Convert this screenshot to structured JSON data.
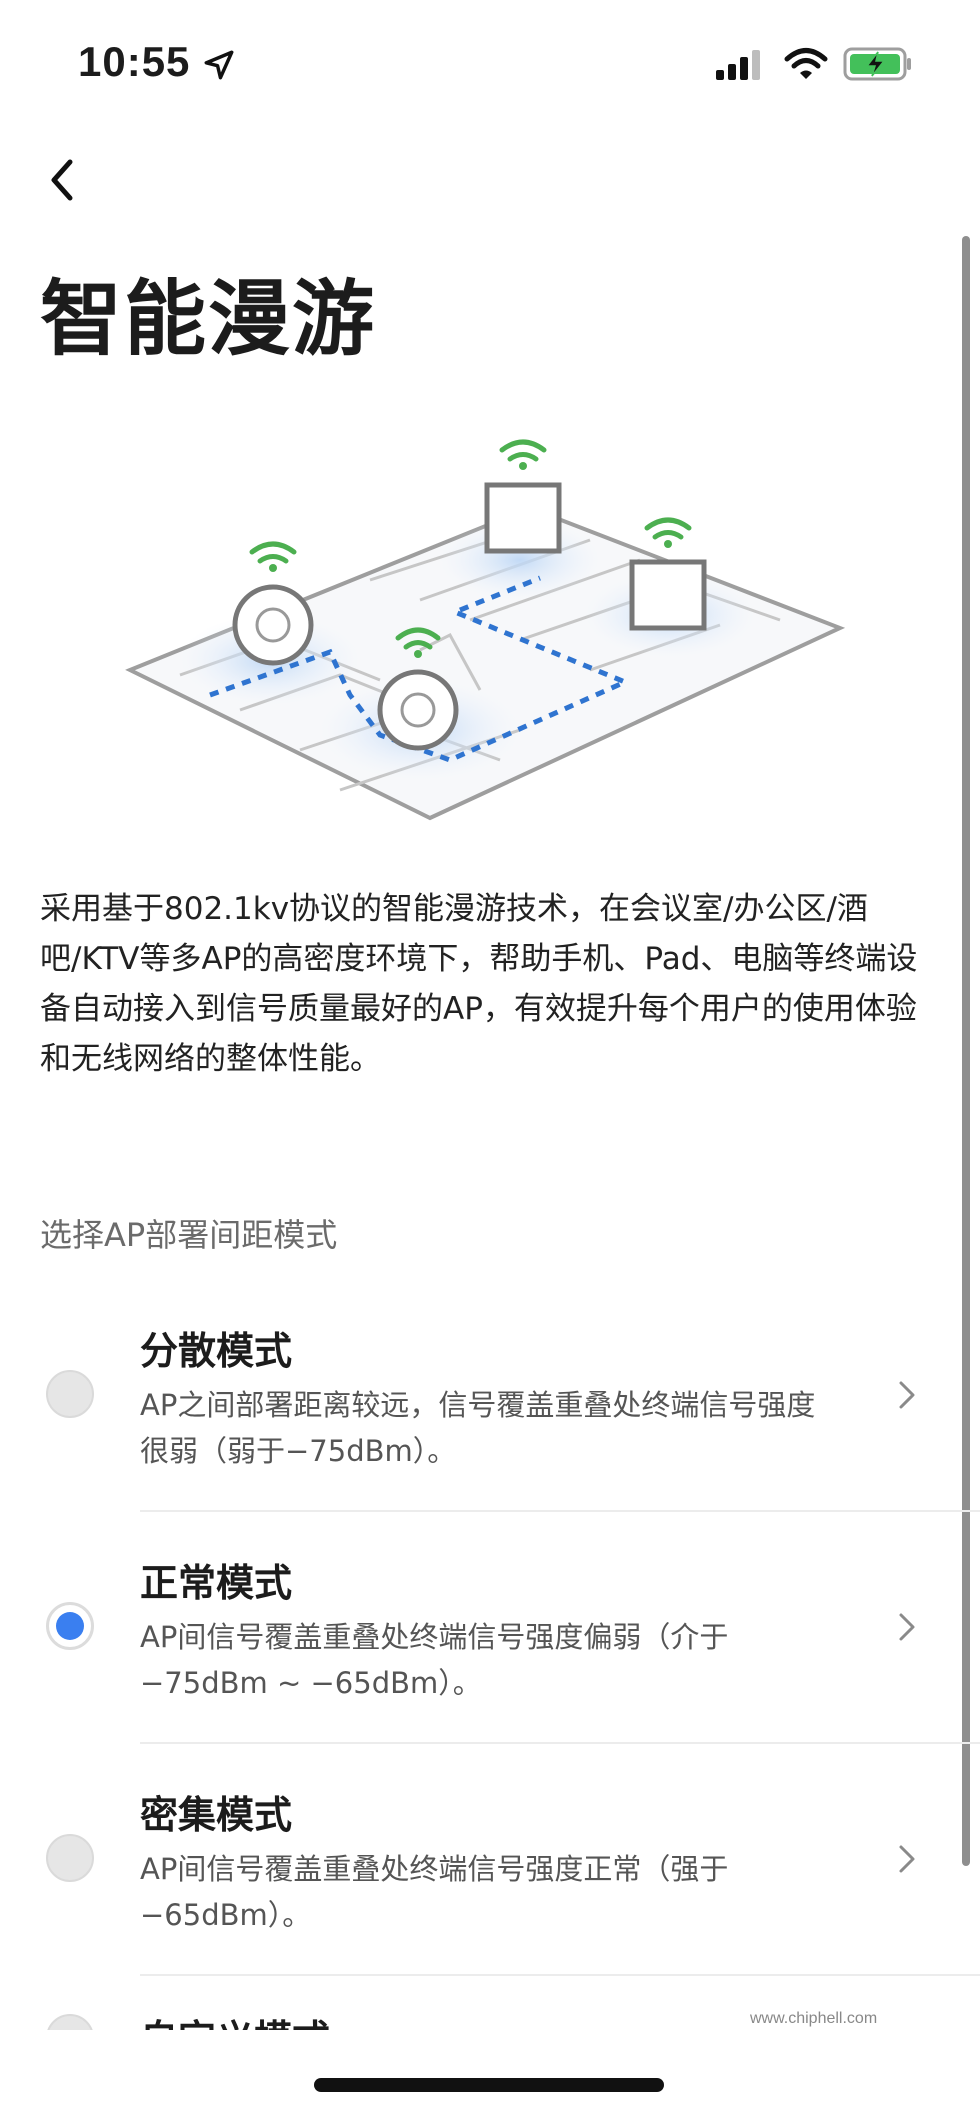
{
  "status_bar": {
    "time": "10:55",
    "location_icon": "location-arrow-icon",
    "signal_icon": "cellular-signal-icon",
    "wifi_icon": "wifi-icon",
    "battery_icon": "battery-charging-icon",
    "battery_color": "#43c05a"
  },
  "nav": {
    "back_icon": "chevron-left-icon"
  },
  "page": {
    "title": "智能漫游",
    "description": "采用基于802.1kv协议的智能漫游技术，在会议室/办公区/酒吧/KTV等多AP的高密度环境下，帮助手机、Pad、电脑等终端设备自动接入到信号质量最好的AP，有效提升每个用户的使用体验和无线网络的整体性能。"
  },
  "illustration": {
    "icon": "roaming-floorplan-illustration",
    "accent": "#2f74d0",
    "wifi_color": "#4caf50"
  },
  "section": {
    "label": "选择AP部署间距模式"
  },
  "options": [
    {
      "title": "分散模式",
      "desc": "AP之间部署距离较远，信号覆盖重叠处终端信号强度很弱（弱于−75dBm）。",
      "selected": false
    },
    {
      "title": "正常模式",
      "desc": "AP间信号覆盖重叠处终端信号强度偏弱（介于−75dBm ~ −65dBm）。",
      "selected": true
    },
    {
      "title": "密集模式",
      "desc": "AP间信号覆盖重叠处终端信号强度正常（强于−65dBm）。",
      "selected": false
    },
    {
      "title": "自定义模式",
      "desc": "",
      "selected": false
    }
  ],
  "colors": {
    "accent": "#3a7ff0",
    "text": "#1c1c1c",
    "muted": "#6b6b6b"
  },
  "watermark": {
    "text": "www.chiphell.com"
  }
}
